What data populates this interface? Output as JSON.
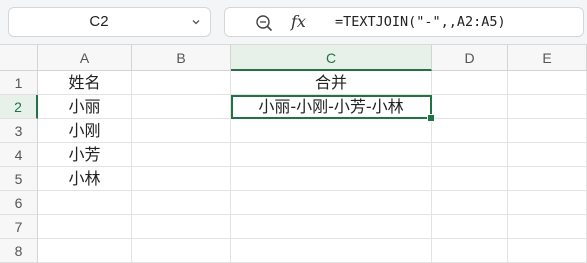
{
  "name_box": {
    "value": "C2"
  },
  "formula_bar": {
    "zoom_icon": "zoom-icon",
    "fx_label": "fx",
    "formula": "=TEXTJOIN(\"-\",,A2:A5)"
  },
  "columns": [
    "A",
    "B",
    "C",
    "D",
    "E"
  ],
  "rows": [
    "1",
    "2",
    "3",
    "4",
    "5",
    "6",
    "7",
    "8"
  ],
  "active_cell": {
    "column": "C",
    "row": "2"
  },
  "cells": {
    "A1": "姓名",
    "A2": "小丽",
    "A3": "小刚",
    "A4": "小芳",
    "A5": "小林",
    "C1": "合并",
    "C2": "小丽-小刚-小芳-小林"
  },
  "colors": {
    "accent": "#217346"
  }
}
